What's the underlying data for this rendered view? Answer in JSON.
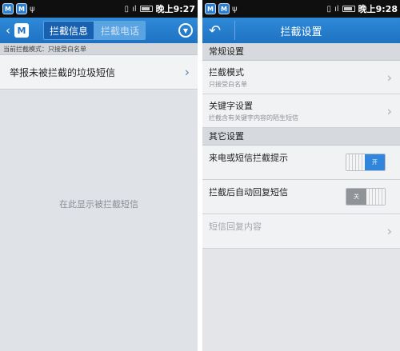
{
  "left": {
    "status": {
      "time": "晚上9:27",
      "badge1": "M",
      "badge2": "M"
    },
    "tabs": [
      {
        "label": "拦截信息"
      },
      {
        "label": "拦截电话"
      }
    ],
    "logo_letter": "M",
    "mode_line": "当前拦截模式：只接受白名单",
    "report_row": "举报未被拦截的垃圾短信",
    "empty_text": "在此显示被拦截短信",
    "icons": {
      "back": "chevron-left-icon",
      "menu": "circle-menu-icon"
    }
  },
  "right": {
    "status": {
      "time": "晚上9:28",
      "badge1": "M",
      "badge2": "M"
    },
    "title": "拦截设置",
    "sections": [
      {
        "header": "常规设置"
      },
      {
        "header": "其它设置"
      }
    ],
    "rows": {
      "intercept_mode": {
        "label": "拦截模式",
        "sub": "只接受白名单"
      },
      "keyword": {
        "label": "关键字设置",
        "sub": "拦截含有关键字内容的陌生短信"
      },
      "notify": {
        "label": "来电或短信拦截提示",
        "state": "开"
      },
      "auto_reply": {
        "label": "拦截后自动回复短信",
        "state": "关"
      },
      "reply_content": {
        "label": "短信回复内容"
      }
    },
    "colors": {
      "accent": "#1f72c2",
      "toggle_on": "#2f86dc",
      "toggle_off": "#909398"
    }
  }
}
